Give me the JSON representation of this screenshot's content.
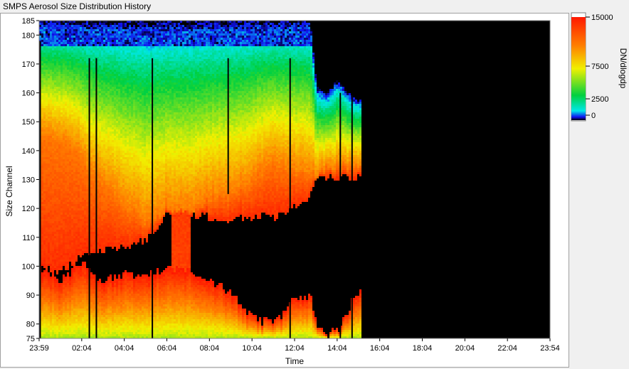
{
  "window": {
    "title": "SMPS Aerosol Size Distribution History"
  },
  "chart_data": {
    "type": "heatmap",
    "title": "SMPS Aerosol Size Distribution History",
    "xlabel": "Time",
    "ylabel": "Size Channel",
    "x_ticks": [
      "23:59",
      "02:04",
      "04:04",
      "06:04",
      "08:04",
      "10:04",
      "12:04",
      "14:04",
      "16:04",
      "18:04",
      "20:04",
      "22:04",
      "23:54"
    ],
    "y_ticks": [
      "75",
      "80",
      "90",
      "100",
      "110",
      "120",
      "130",
      "140",
      "150",
      "160",
      "170",
      "180",
      "185"
    ],
    "ylim": [
      75,
      185
    ],
    "colorbar": {
      "label": "DN/dlogdp",
      "ticks": [
        "15000",
        "7500",
        "2500",
        "0"
      ],
      "range": [
        0,
        15000
      ],
      "colors": [
        "#000000",
        "#1010f0",
        "#00e8e8",
        "#00d040",
        "#f0f000",
        "#ff8000",
        "#ff1800"
      ],
      "saturated_color": "#ffffff"
    },
    "data_end_time": "15:00",
    "no_data_color": "#000000",
    "profile_hours": [
      0,
      1,
      2,
      2.4,
      3,
      4,
      5,
      6,
      7,
      8,
      9,
      10,
      11,
      12,
      12.7,
      13,
      13.5,
      14,
      14.5,
      14.8,
      15.0
    ],
    "profile_low_top": [
      100,
      95,
      101,
      98,
      95,
      97,
      96,
      100,
      99,
      95,
      91,
      82,
      80,
      89,
      90,
      80,
      76,
      78,
      85,
      91,
      91
    ],
    "profile_mid_bottom": [
      100,
      98,
      103,
      104,
      105,
      107,
      109,
      118,
      118,
      117,
      116,
      117,
      117,
      121,
      124,
      130,
      131,
      131,
      131,
      131,
      131
    ],
    "profile_mid_top": [
      145,
      143,
      138,
      132,
      128,
      121,
      115,
      120,
      119,
      123,
      125,
      130,
      135,
      132,
      132,
      131,
      134,
      134,
      134,
      134,
      134
    ],
    "profile_edge_top": [
      185,
      185,
      185,
      185,
      185,
      185,
      185,
      185,
      185,
      185,
      185,
      185,
      185,
      185,
      185,
      162,
      160,
      165,
      160,
      158,
      158
    ],
    "dropout_lines": [
      {
        "hour": 0.05,
        "from": 75,
        "to": 178
      },
      {
        "hour": 2.35,
        "from": 75,
        "to": 172
      },
      {
        "hour": 2.68,
        "from": 75,
        "to": 172
      },
      {
        "hour": 5.3,
        "from": 75,
        "to": 172
      },
      {
        "hour": 8.85,
        "from": 125,
        "to": 172
      },
      {
        "hour": 11.75,
        "from": 75,
        "to": 172
      },
      {
        "hour": 14.1,
        "from": 75,
        "to": 160
      },
      {
        "hour": 14.65,
        "from": 75,
        "to": 160
      }
    ]
  }
}
